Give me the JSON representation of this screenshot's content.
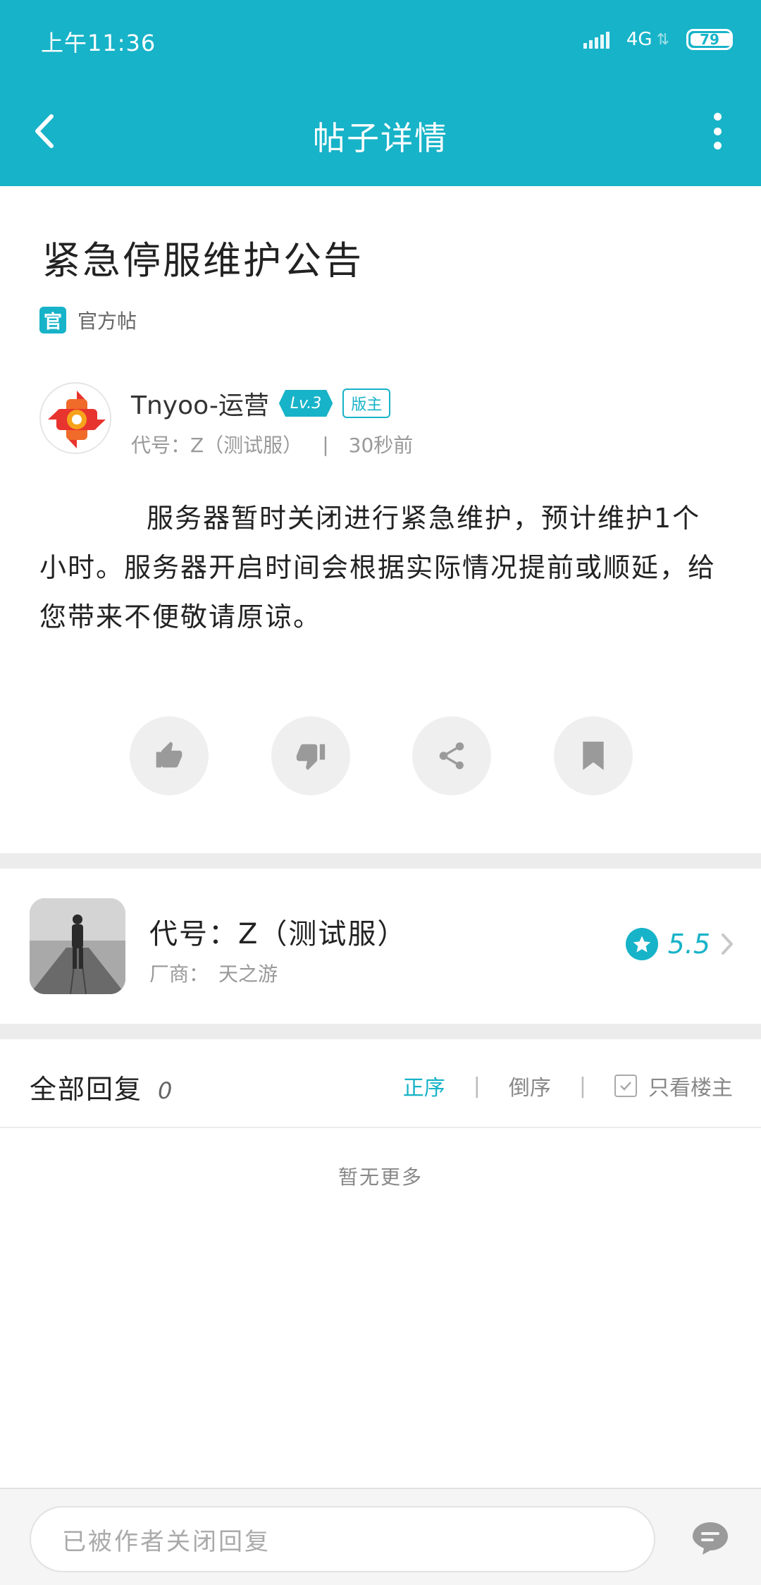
{
  "status_bar": {
    "time": "上午11:36",
    "network": "4G",
    "battery": "79",
    "battery_level": 0.79
  },
  "nav": {
    "title": "帖子详情",
    "back_icon": "back-arrow-icon",
    "more_icon": "more-vertical-icon"
  },
  "post": {
    "title": "紧急停服维护公告",
    "official_badge": "官",
    "official_label": "官方帖",
    "author": {
      "name": "Tnyoo-运营",
      "level": "Lv.3",
      "role_badge": "版主",
      "game": "代号：Z（测试服）",
      "separator": "|",
      "time": "30秒前"
    },
    "body": "服务器暂时关闭进行紧急维护，预计维护1个小时。服务器开启时间会根据实际情况提前或顺延，给您带来不便敬请原谅。",
    "actions": [
      "thumbs-up-icon",
      "thumbs-down-icon",
      "share-icon",
      "bookmark-icon"
    ]
  },
  "game_card": {
    "name": "代号：Z（测试服）",
    "vendor_label": "厂商：",
    "vendor": "天之游",
    "rating": "5.5"
  },
  "replies": {
    "title": "全部回复",
    "count": "0",
    "sort_asc": "正序",
    "sort_desc": "倒序",
    "divider": "|",
    "author_only": "只看楼主",
    "empty": "暂无更多"
  },
  "bottom": {
    "input_placeholder": "已被作者关闭回复"
  },
  "colors": {
    "accent": "#17b3c8"
  }
}
